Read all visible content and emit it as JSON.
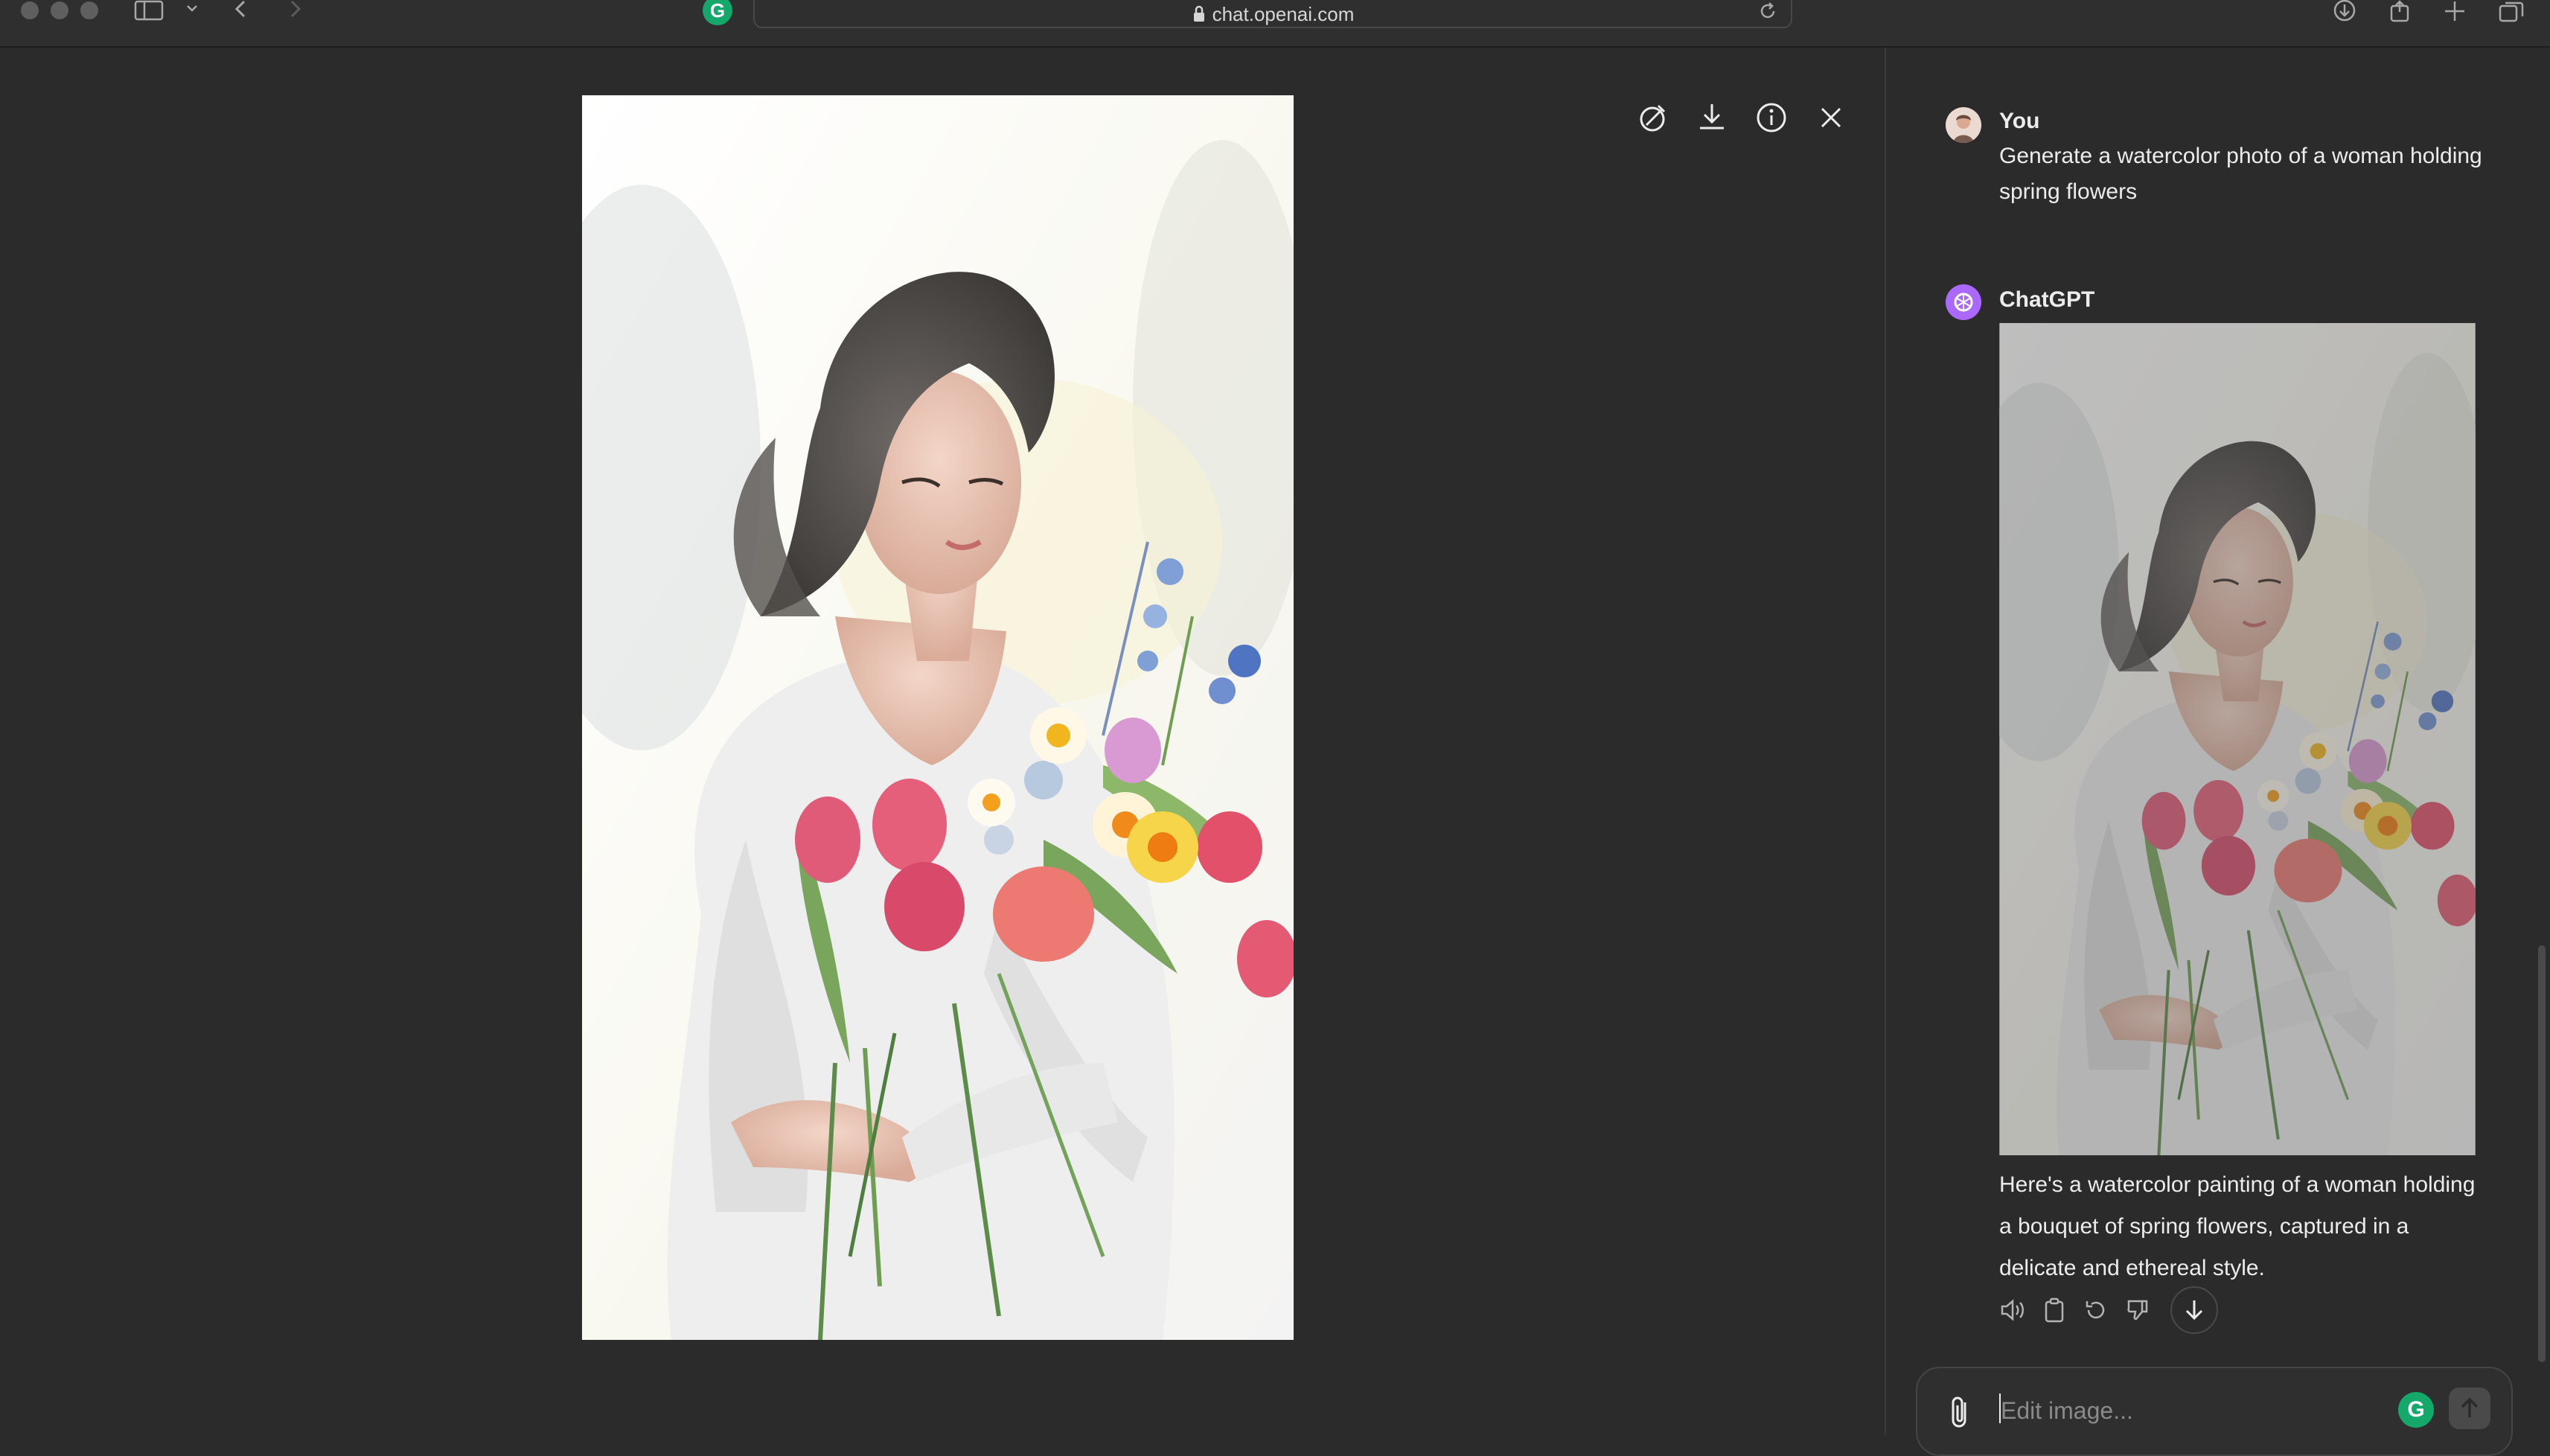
{
  "browser": {
    "url": "chat.openai.com"
  },
  "viewer": {
    "image_alt": "watercolor woman holding spring flowers"
  },
  "chat": {
    "user": {
      "name": "You",
      "message": "Generate a watercolor photo of a woman holding spring flowers"
    },
    "assistant": {
      "name": "ChatGPT",
      "reply": "Here's a watercolor painting of a woman holding a bouquet of spring flowers, captured in a delicate and ethereal style."
    },
    "composer": {
      "placeholder": "Edit image..."
    }
  },
  "colors": {
    "background": "#2b2b2b",
    "assistant_avatar": "#ab68ff",
    "grammarly": "#14a86b"
  }
}
